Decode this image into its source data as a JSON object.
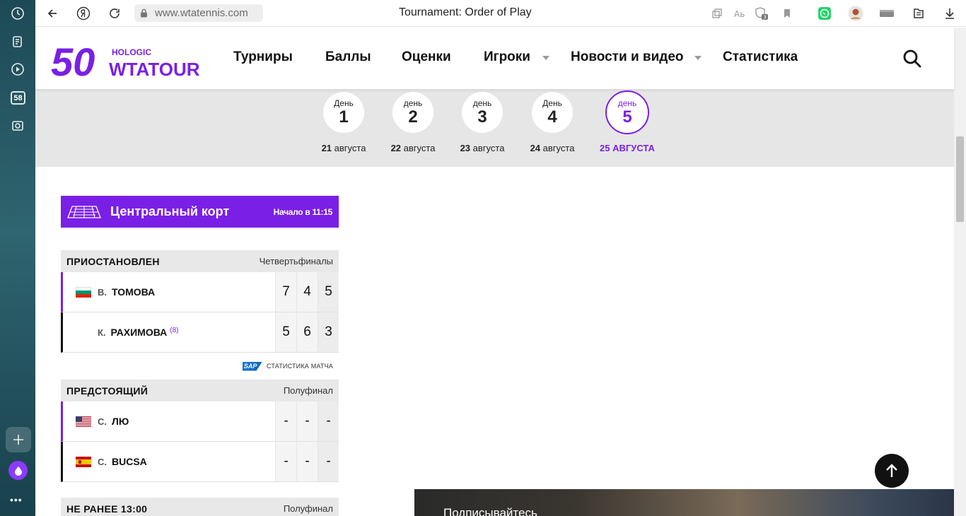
{
  "browser": {
    "url": "www.wtatennis.com",
    "title": "Tournament: Order of Play",
    "sidebar_badge": "58",
    "bookmark_badge": "3"
  },
  "site": {
    "logo": {
      "fifty": "50",
      "sponsor": "HOLOGIC",
      "brand": "WTATOUR"
    },
    "nav": [
      "Турниры",
      "Баллы",
      "Оценки",
      "Игроки",
      "Новости и видео",
      "Статистика"
    ]
  },
  "days": [
    {
      "word": "День",
      "num": "1",
      "date_num": "21",
      "date_month": "августа"
    },
    {
      "word": "день",
      "num": "2",
      "date_num": "22",
      "date_month": "августа"
    },
    {
      "word": "день",
      "num": "3",
      "date_num": "23",
      "date_month": "августа"
    },
    {
      "word": "День",
      "num": "4",
      "date_num": "24",
      "date_month": "августа"
    },
    {
      "word": "день",
      "num": "5",
      "date_full": "25 АВГУСТА",
      "active": true
    }
  ],
  "court": {
    "name": "Центральный корт",
    "start": "Начало в 11:15",
    "matches": [
      {
        "status": "ПРИОСТАНОВЛЕН",
        "round": "Четвертьфиналы",
        "players": [
          {
            "initial": "В.",
            "last": "ТОМОВА",
            "seed": "",
            "flag": "BGR",
            "scores": [
              "7",
              "4",
              "5"
            ]
          },
          {
            "initial": "К.",
            "last": "РАХИМОВА",
            "seed": "(8)",
            "flag": "",
            "scores": [
              "5",
              "6",
              "3"
            ]
          }
        ],
        "stats_logo": "SAP",
        "stats_label": "СТАТИСТИКА МАТЧА"
      },
      {
        "status": "ПРЕДСТОЯЩИЙ",
        "round": "Полуфинал",
        "players": [
          {
            "initial": "С.",
            "last": "ЛЮ",
            "seed": "",
            "flag": "USA",
            "scores": [
              "-",
              "-",
              "-"
            ]
          },
          {
            "initial": "С.",
            "last": "BUCSA",
            "seed": "",
            "flag": "ESP",
            "scores": [
              "-",
              "-",
              "-"
            ]
          }
        ]
      },
      {
        "status": "НЕ РАНЕЕ 13:00",
        "round": "Полуфинал"
      }
    ]
  },
  "banner": {
    "text": "Подписывайтесь"
  },
  "colors": {
    "accent": "#7a1fe6",
    "dark": "#111111",
    "strip": "#e6e6e6"
  }
}
